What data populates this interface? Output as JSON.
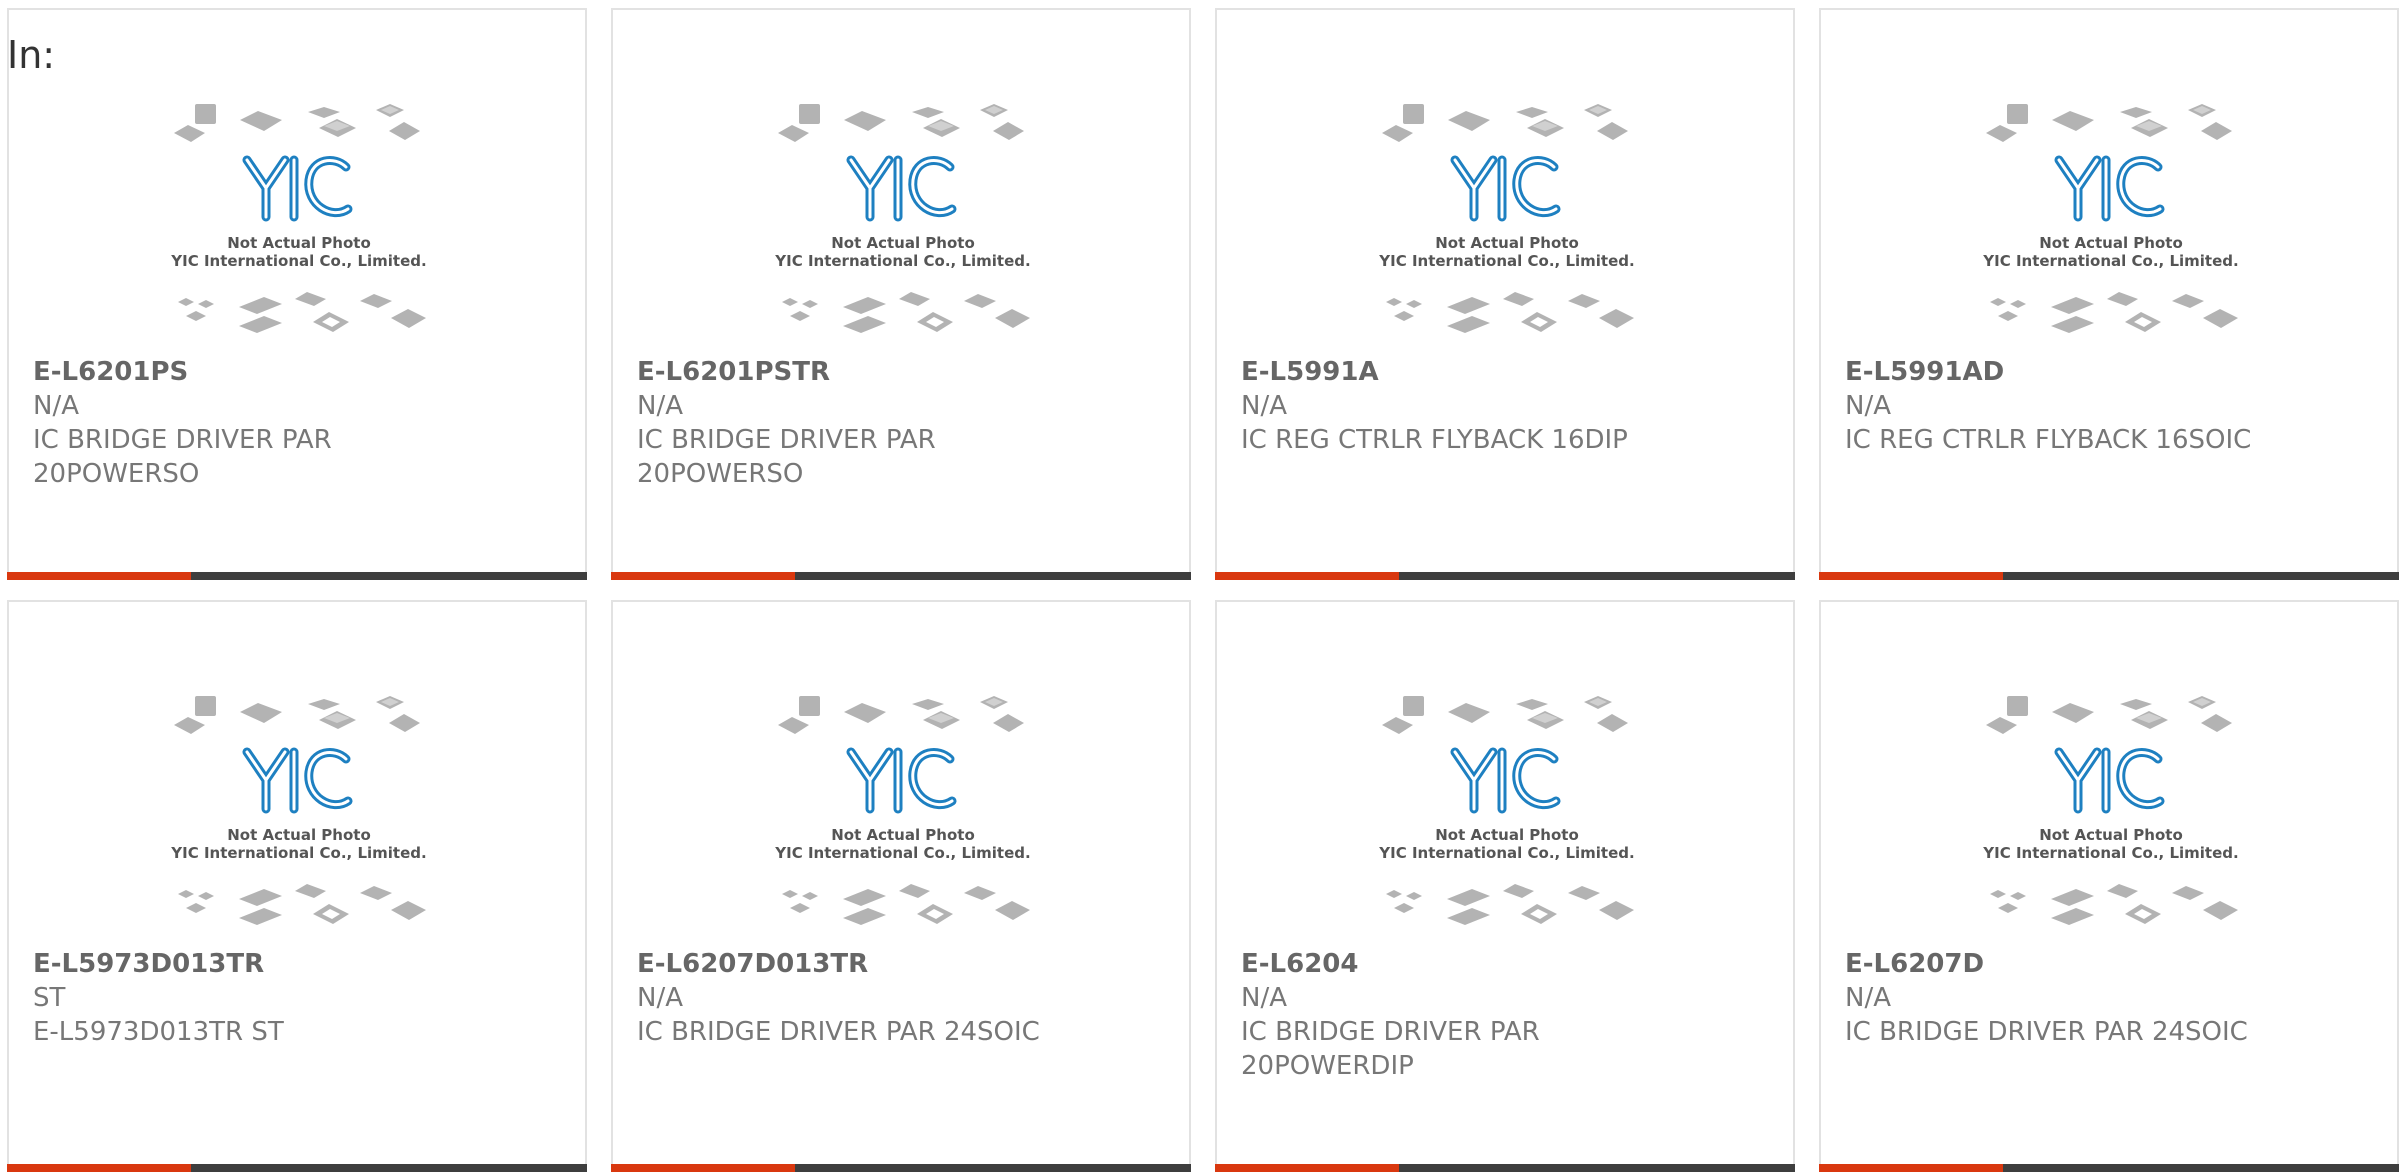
{
  "header": {
    "in_label": "In:"
  },
  "colors": {
    "accent": "#d9380f",
    "bar_dark": "#3e3e3e",
    "logo_blue": "#1e80c1"
  },
  "placeholder_image": {
    "caption_line1": "Not Actual Photo",
    "caption_line2": "YIC International Co., Limited.",
    "logo_text": "YIC"
  },
  "products": [
    {
      "part": "E-L6201PS",
      "manufacturer": "N/A",
      "desc_line1": "IC BRIDGE DRIVER PAR",
      "desc_line2": "20POWERSO"
    },
    {
      "part": "E-L6201PSTR",
      "manufacturer": "N/A",
      "desc_line1": "IC BRIDGE DRIVER PAR",
      "desc_line2": "20POWERSO"
    },
    {
      "part": "E-L5991A",
      "manufacturer": "N/A",
      "desc_line1": "IC REG CTRLR FLYBACK 16DIP",
      "desc_line2": ""
    },
    {
      "part": "E-L5991AD",
      "manufacturer": "N/A",
      "desc_line1": "IC REG CTRLR FLYBACK 16SOIC",
      "desc_line2": ""
    },
    {
      "part": "E-L5973D013TR",
      "manufacturer": "ST",
      "desc_line1": "E-L5973D013TR ST",
      "desc_line2": ""
    },
    {
      "part": "E-L6207D013TR",
      "manufacturer": "N/A",
      "desc_line1": "IC BRIDGE DRIVER PAR 24SOIC",
      "desc_line2": ""
    },
    {
      "part": "E-L6204",
      "manufacturer": "N/A",
      "desc_line1": "IC BRIDGE DRIVER PAR",
      "desc_line2": "20POWERDIP"
    },
    {
      "part": "E-L6207D",
      "manufacturer": "N/A",
      "desc_line1": "IC BRIDGE DRIVER PAR 24SOIC",
      "desc_line2": ""
    }
  ]
}
